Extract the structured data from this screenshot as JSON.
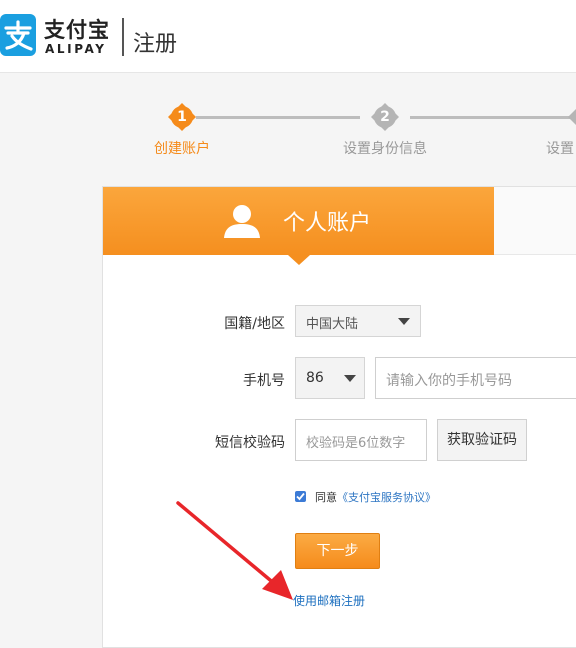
{
  "header": {
    "logo_cn": "支付宝",
    "logo_en": "ALIPAY",
    "page_title": "注册",
    "brand_color": "#1a9fe0"
  },
  "steps": [
    {
      "number": "1",
      "label": "创建账户",
      "state": "active",
      "color": "#f58b1b"
    },
    {
      "number": "2",
      "label": "设置身份信息",
      "state": "inactive",
      "color": "#b5b5b5"
    },
    {
      "number": "",
      "label": "设置",
      "state": "inactive",
      "color": "#b5b5b5"
    }
  ],
  "tabs": {
    "personal_label": "个人账户",
    "accent_color": "#f79a2d"
  },
  "form": {
    "country_label": "国籍/地区",
    "country_value": "中国大陆",
    "phone_label": "手机号",
    "phone_code": "86",
    "phone_placeholder": "请输入你的手机号码",
    "sms_label": "短信校验码",
    "sms_placeholder": "校验码是6位数字",
    "sms_button": "获取验证码",
    "agree_prefix": "同意",
    "agree_link": "《支付宝服务协议》",
    "agree_checked": true,
    "next_button": "下一步",
    "email_register_link": "使用邮箱注册"
  },
  "annotation": {
    "arrow_color": "#e8262a"
  }
}
